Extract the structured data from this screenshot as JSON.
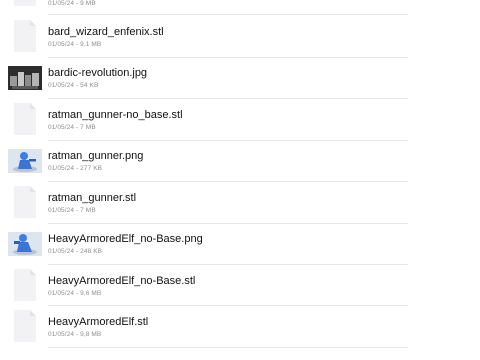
{
  "files": [
    {
      "name": "",
      "meta": "01/05/24 - 9 MB",
      "thumb": "document-icon"
    },
    {
      "name": "bard_wizard_enfenix.stl",
      "meta": "01/05/24 - 9,1 MB",
      "thumb": "document-icon"
    },
    {
      "name": "bardic-revolution.jpg",
      "meta": "01/05/24 - 54 KB",
      "thumb": "dark-image-thumbnail"
    },
    {
      "name": "ratman_gunner-no_base.stl",
      "meta": "01/05/24 - 7 MB",
      "thumb": "document-icon"
    },
    {
      "name": "ratman_gunner.png",
      "meta": "01/05/24 - 277 KB",
      "thumb": "blue-figure-thumbnail"
    },
    {
      "name": "ratman_gunner.stl",
      "meta": "01/05/24 - 7 MB",
      "thumb": "document-icon"
    },
    {
      "name": "HeavyArmoredElf_no-Base.png",
      "meta": "01/05/24 - 248 KB",
      "thumb": "blue-figure-thumbnail"
    },
    {
      "name": "HeavyArmoredElf_no-Base.stl",
      "meta": "01/05/24 - 9,6 MB",
      "thumb": "document-icon"
    },
    {
      "name": "HeavyArmoredElf.stl",
      "meta": "01/05/24 - 9,8 MB",
      "thumb": "document-icon"
    }
  ],
  "colors": {
    "separator": "#e6e6e8",
    "meta_text": "#8e8e93",
    "doc_fill": "#f2f2f4",
    "blue_figure": "#3f7ee0"
  }
}
